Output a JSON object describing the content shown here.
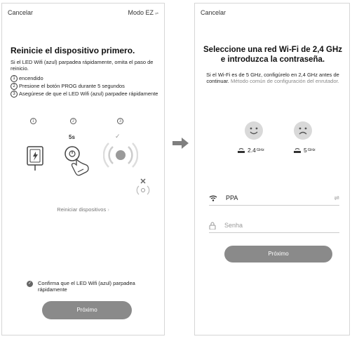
{
  "left": {
    "cancel": "Cancelar",
    "mode": "Modo EZ",
    "title": "Reinicie el dispositivo primero.",
    "description": "Si el LED Wifi (azul) parpadea rápidamente, omita el paso de reinicio.",
    "steps": [
      {
        "num": "1",
        "text": "encendido"
      },
      {
        "num": "2",
        "text": "Presione el botón PROG durante 5 segundos"
      },
      {
        "num": "3",
        "text": "Asegúrese de que el LED Wifi (azul) parpadee rápidamente"
      }
    ],
    "illustration": {
      "step_nums": [
        "1",
        "2",
        "3"
      ],
      "hold_time": "5s"
    },
    "restart_link": "Reiniciar dispositivos",
    "confirm_text": "Confirma que el LED Wifi (azul) parpadea rápidamente",
    "next_button": "Próximo"
  },
  "right": {
    "cancel": "Cancelar",
    "title": "Seleccione una red Wi-Fi de 2,4 GHz e introduzca la contraseña.",
    "description_main": "Si el Wi-Fi es de 5 GHz, configúrelo en 2,4 GHz antes de continuar.",
    "description_grey": "Método común de configuración del enrutador.",
    "band_good": {
      "value": "2.4",
      "unit": "GHz"
    },
    "band_bad": {
      "value": "5",
      "unit": "GHz"
    },
    "wifi_name": "PPA",
    "password_placeholder": "Senha",
    "next_button": "Próximo"
  },
  "colors": {
    "button": "#8a8a8a",
    "arrow": "#7f7f7f",
    "face": "#d9d9d9"
  },
  "icons": [
    "wifi-icon",
    "lock-icon",
    "swap-icon",
    "router-icon",
    "smile-icon",
    "sad-icon",
    "plug-icon",
    "hand-press-icon",
    "blink-icon",
    "no-signal-icon",
    "check-icon",
    "chevron-right-icon"
  ]
}
